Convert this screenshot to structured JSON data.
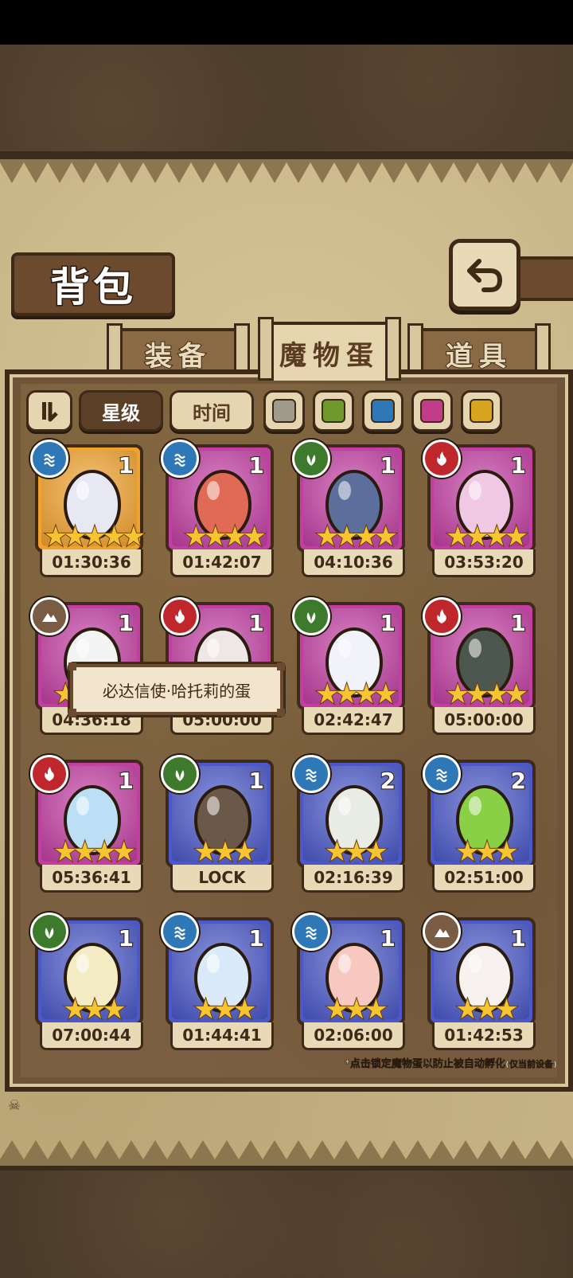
{
  "header": {
    "title": "背包"
  },
  "tabs": [
    {
      "label": "装备",
      "active": false
    },
    {
      "label": "魔物蛋",
      "active": true
    },
    {
      "label": "道具",
      "active": false
    }
  ],
  "filters": {
    "sort_star": "星级",
    "sort_time": "时间",
    "colors": [
      "#a09a8c",
      "#6e9a2c",
      "#2f78b8",
      "#c23c8a",
      "#d7a41e"
    ]
  },
  "element_colors": {
    "water": "#2f78b8",
    "grass": "#3d7a2c",
    "fire": "#c0272d",
    "earth": "#7a5b44"
  },
  "rarity_colors": {
    "gold": "#f2a22c",
    "purple": "#c33ea3",
    "blue": "#4a58c9"
  },
  "eggs": [
    {
      "element": "water",
      "rarity": "gold",
      "count": "1",
      "stars": 5,
      "star_text": "★★★★★",
      "timer": "01:30:36",
      "art_color": "#e8e8f5"
    },
    {
      "element": "water",
      "rarity": "purple",
      "count": "1",
      "stars": 4,
      "star_text": "★★★★",
      "timer": "01:42:07",
      "art_color": "#e06a55"
    },
    {
      "element": "grass",
      "rarity": "purple",
      "count": "1",
      "stars": 4,
      "star_text": "★★★★",
      "timer": "04:10:36",
      "art_color": "#5b6e9c"
    },
    {
      "element": "fire",
      "rarity": "purple",
      "count": "1",
      "stars": 4,
      "star_text": "★★★★",
      "timer": "03:53:20",
      "art_color": "#f0c8e4"
    },
    {
      "element": "earth",
      "rarity": "purple",
      "count": "1",
      "stars": 4,
      "star_text": "★★★★",
      "timer": "04:36:18",
      "art_color": "#f4f4f4"
    },
    {
      "element": "fire",
      "rarity": "purple",
      "count": "1",
      "stars": 4,
      "star_text": "★★★★",
      "timer": "05:00:00",
      "art_color": "#efe7e7"
    },
    {
      "element": "grass",
      "rarity": "purple",
      "count": "1",
      "stars": 4,
      "star_text": "★★★★",
      "timer": "02:42:47",
      "art_color": "#f2f2fa"
    },
    {
      "element": "fire",
      "rarity": "purple",
      "count": "1",
      "stars": 4,
      "star_text": "★★★★",
      "timer": "05:00:00",
      "art_color": "#4c5750"
    },
    {
      "element": "fire",
      "rarity": "purple",
      "count": "1",
      "stars": 4,
      "star_text": "★★★★",
      "timer": "05:36:41",
      "art_color": "#bcdff5"
    },
    {
      "element": "grass",
      "rarity": "blue",
      "count": "1",
      "stars": 3,
      "star_text": "★★★",
      "timer": "LOCK",
      "art_color": "#6a5848"
    },
    {
      "element": "water",
      "rarity": "blue",
      "count": "2",
      "stars": 3,
      "star_text": "★★★",
      "timer": "02:16:39",
      "art_color": "#e9ece4"
    },
    {
      "element": "water",
      "rarity": "blue",
      "count": "2",
      "stars": 3,
      "star_text": "★★★",
      "timer": "02:51:00",
      "art_color": "#8ad046"
    },
    {
      "element": "grass",
      "rarity": "blue",
      "count": "1",
      "stars": 3,
      "star_text": "★★★",
      "timer": "07:00:44",
      "art_color": "#f3ecc4"
    },
    {
      "element": "water",
      "rarity": "blue",
      "count": "1",
      "stars": 3,
      "star_text": "★★★",
      "timer": "01:44:41",
      "art_color": "#dbeaf8"
    },
    {
      "element": "water",
      "rarity": "blue",
      "count": "1",
      "stars": 3,
      "star_text": "★★★",
      "timer": "02:06:00",
      "art_color": "#f6c8c0"
    },
    {
      "element": "earth",
      "rarity": "blue",
      "count": "1",
      "stars": 3,
      "star_text": "★★★",
      "timer": "01:42:53",
      "art_color": "#f7f1f0"
    }
  ],
  "tooltip": {
    "text": "必达信使·哈托莉的蛋"
  },
  "footer_note": {
    "main": "*点击锁定魔物蛋以防止被自动孵化",
    "sub": "(仅当前设备)"
  }
}
